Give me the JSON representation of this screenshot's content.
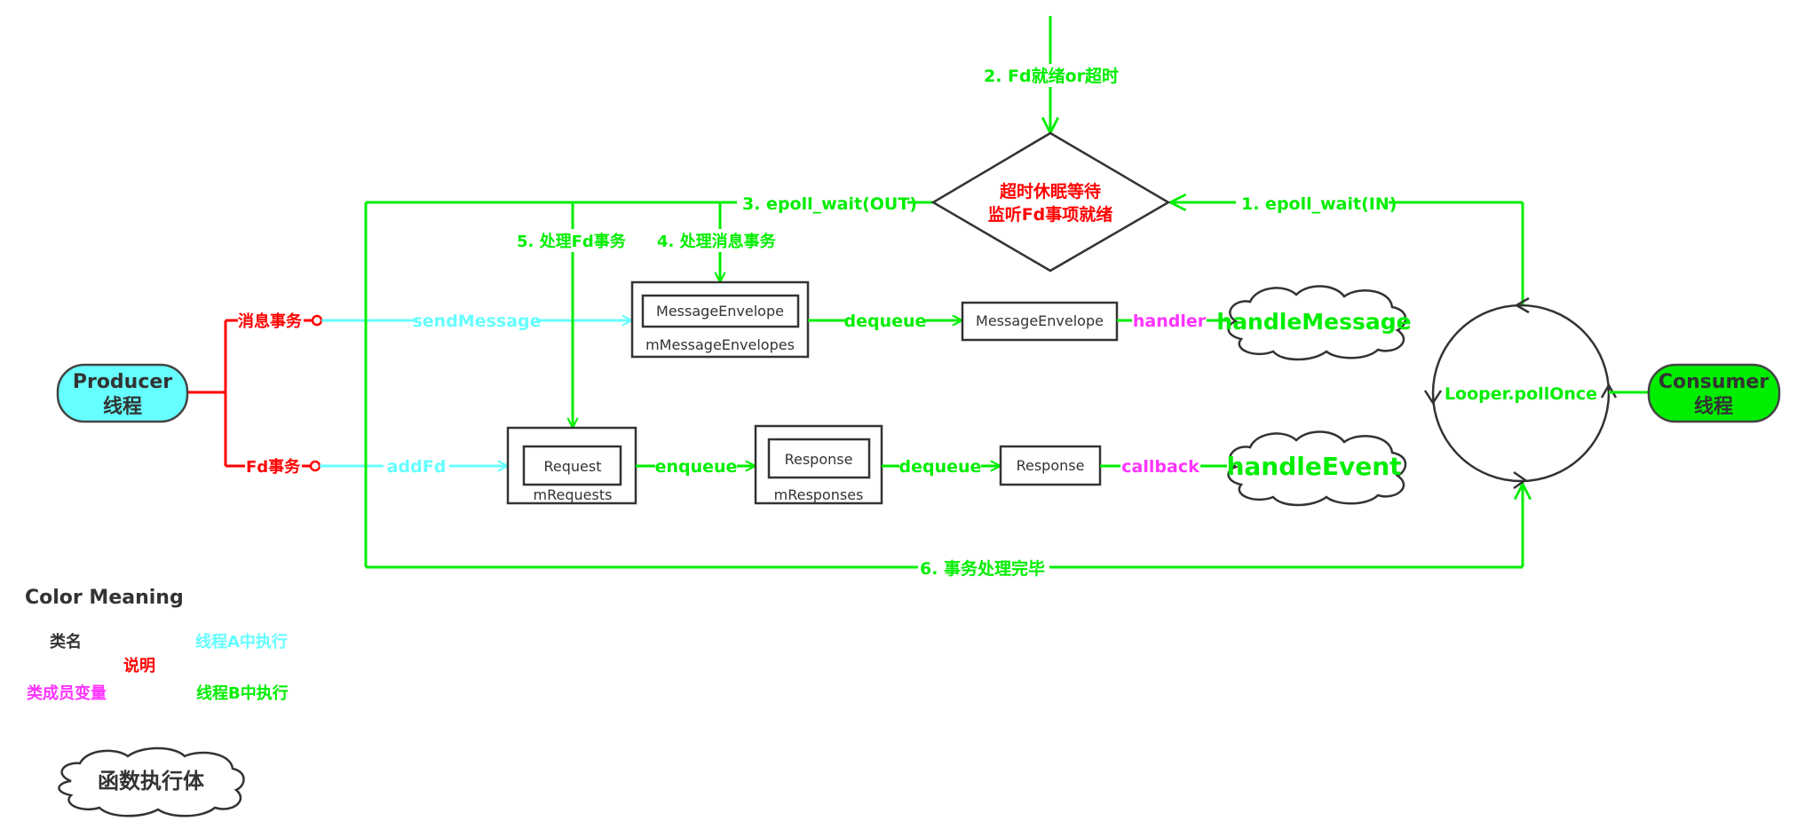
{
  "colors": {
    "thread_a": "#66ffff",
    "thread_b": "#00ee00",
    "note": "#ff0000",
    "member": "#ff33ff",
    "class": "#333333",
    "producer_fill": "#66ffff",
    "consumer_fill": "#00ee00"
  },
  "producer": {
    "title": "Producer",
    "subtitle": "线程"
  },
  "consumer": {
    "title": "Consumer",
    "subtitle": "线程"
  },
  "branches": {
    "message": "消息事务",
    "fd": "Fd事务"
  },
  "edges": {
    "send_message": "sendMessage",
    "add_fd": "addFd",
    "dequeue_msg": "dequeue",
    "enqueue": "enqueue",
    "dequeue_resp": "dequeue",
    "handler": "handler",
    "callback": "callback",
    "step1": "1. epoll_wait(IN)",
    "step2": "2. Fd就绪or超时",
    "step3": "3. epoll_wait(OUT)",
    "step4": "4. 处理消息事务",
    "step5": "5. 处理Fd事务",
    "step6": "6. 事务处理完毕"
  },
  "decision": {
    "line1": "超时休眠等待",
    "line2": "监听Fd事项就绪"
  },
  "containers": {
    "message_envelopes": {
      "inner": "MessageEnvelope",
      "name": "mMessageEnvelopes"
    },
    "requests": {
      "inner": "Request",
      "name": "mRequests"
    },
    "responses": {
      "inner": "Response",
      "name": "mResponses"
    }
  },
  "nodes": {
    "message_envelope": "MessageEnvelope",
    "response": "Response",
    "handle_message": "handleMessage",
    "handle_event": "handleEvent",
    "looper": "Looper.pollOnce"
  },
  "legend": {
    "title": "Color Meaning",
    "class_name": "类名",
    "note": "说明",
    "member": "类成员变量",
    "thread_a": "线程A中执行",
    "thread_b": "线程B中执行",
    "function_body": "函数执行体"
  }
}
